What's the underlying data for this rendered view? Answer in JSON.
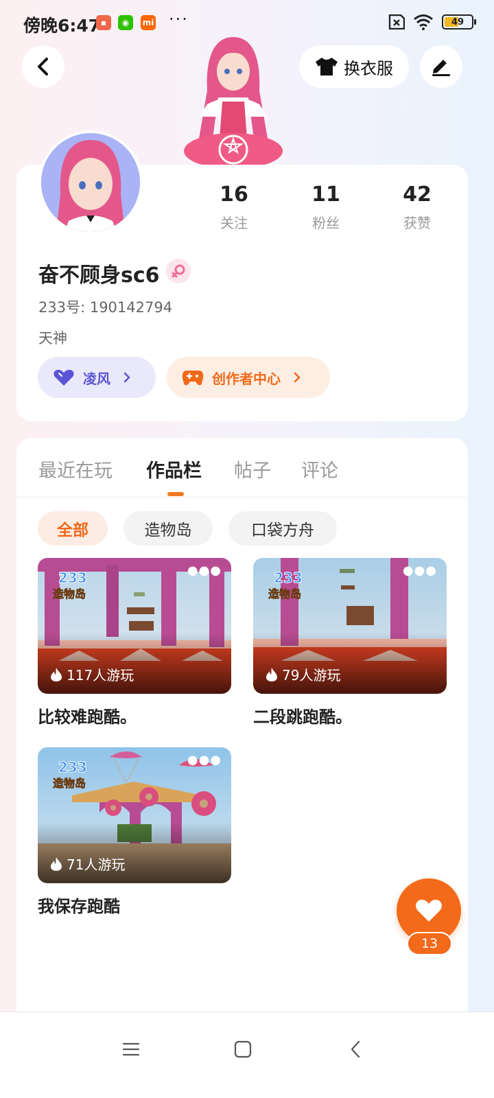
{
  "status_bar": {
    "time": "傍晚6:47",
    "apps": [
      {
        "name": "app-red",
        "color": "#f0674a"
      },
      {
        "name": "wechat",
        "color": "#2dc100"
      },
      {
        "name": "mi",
        "color": "#ff6700"
      }
    ],
    "more": "···",
    "battery_level": "49"
  },
  "header": {
    "outfit_label": "换衣服"
  },
  "profile": {
    "stats": [
      {
        "value": "16",
        "label": "关注"
      },
      {
        "value": "11",
        "label": "粉丝"
      },
      {
        "value": "42",
        "label": "获赞"
      }
    ],
    "nickname": "奋不顾身sc6",
    "uid": "233号: 190142794",
    "title": "天神",
    "badge_label": "凌风",
    "creator_label": "创作者中心"
  },
  "tabs": [
    {
      "label": "最近在玩",
      "active": false
    },
    {
      "label": "作品栏",
      "active": true
    },
    {
      "label": "帖子",
      "active": false
    },
    {
      "label": "评论",
      "active": false
    }
  ],
  "filters": [
    {
      "label": "全部",
      "active": true
    },
    {
      "label": "造物岛",
      "active": false
    },
    {
      "label": "口袋方舟",
      "active": false
    }
  ],
  "games": [
    {
      "title": "比较难跑酷。",
      "plays": "117人游玩"
    },
    {
      "title": "二段跳跑酷。",
      "plays": "79人游玩"
    },
    {
      "title": "我保存跑酷",
      "plays": "71人游玩"
    }
  ],
  "like_fab": {
    "count": "13"
  },
  "colors": {
    "accent": "#f26a1a",
    "purple": "#5b55d6",
    "pink": "#f06a9a"
  }
}
